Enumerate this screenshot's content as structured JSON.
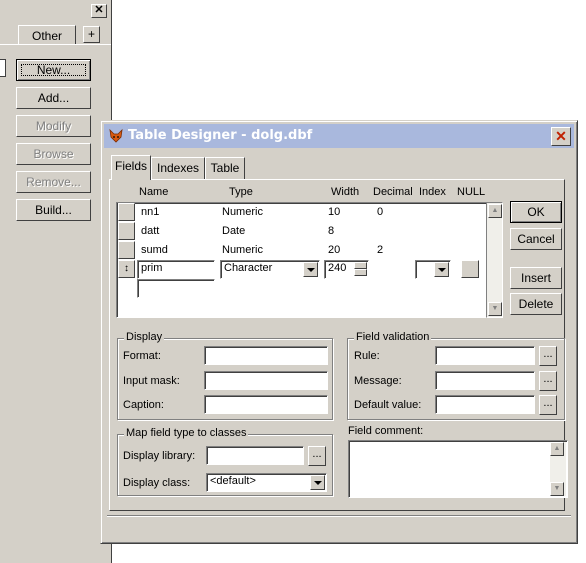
{
  "project_manager": {
    "tab_other": "Other",
    "tab_plus": "+",
    "close": "✕",
    "buttons": {
      "new": "New...",
      "add": "Add...",
      "modify": "Modify",
      "browse": "Browse",
      "remove": "Remove...",
      "build": "Build..."
    }
  },
  "dialog": {
    "title": "Table Designer - dolg.dbf",
    "close": "✕",
    "tabs": [
      "Fields",
      "Indexes",
      "Table"
    ],
    "columns": {
      "name": "Name",
      "type": "Type",
      "width": "Width",
      "decimal": "Decimal",
      "index": "Index",
      "null": "NULL"
    },
    "rows": [
      {
        "name": "nn1",
        "type": "Numeric",
        "width": "10",
        "decimal": "0"
      },
      {
        "name": "datt",
        "type": "Date",
        "width": "8",
        "decimal": ""
      },
      {
        "name": "sumd",
        "type": "Numeric",
        "width": "20",
        "decimal": "2"
      }
    ],
    "edit_row": {
      "marker": "↕",
      "name": "prim",
      "type": "Character",
      "width": "240"
    },
    "buttons": {
      "ok": "OK",
      "cancel": "Cancel",
      "insert": "Insert",
      "delete": "Delete"
    },
    "display": {
      "group": "Display",
      "format": "Format:",
      "input_mask": "Input mask:",
      "caption": "Caption:"
    },
    "validation": {
      "group": "Field validation",
      "rule": "Rule:",
      "message": "Message:",
      "default_value": "Default value:"
    },
    "mapping": {
      "group": "Map field type to classes",
      "library": "Display library:",
      "class": "Display class:",
      "class_value": "<default>"
    },
    "comment": {
      "label": "Field comment:"
    },
    "ellipsis": "..."
  }
}
